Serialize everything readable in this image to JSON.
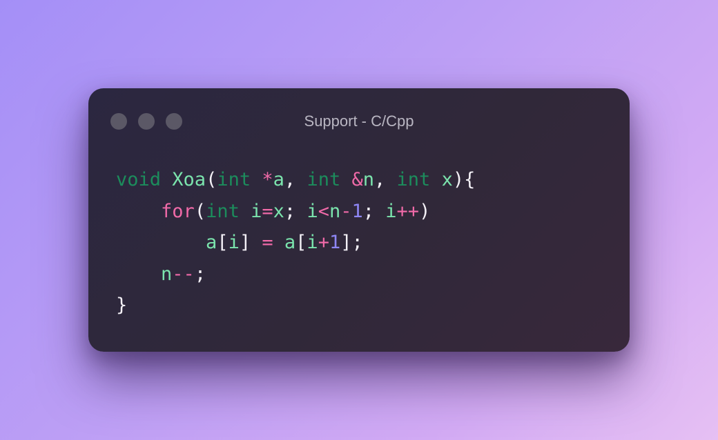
{
  "window": {
    "title": "Support - C/Cpp",
    "language": "C/C++",
    "buttons": [
      "close-dot",
      "minimize-dot",
      "maximize-dot"
    ]
  },
  "colors": {
    "background_start": "#a48ff7",
    "background_end": "#e6c0f3",
    "window_bg": "#2b2740",
    "keyword": "#1c8c5c",
    "identifier": "#7be4ad",
    "operator": "#f06aa8",
    "number": "#8e86f4",
    "punctuation": "#f3f0f6"
  },
  "code": {
    "lines": [
      [
        {
          "t": "void",
          "k": "kw"
        },
        {
          "t": " ",
          "k": "pu"
        },
        {
          "t": "Xoa",
          "k": "fn"
        },
        {
          "t": "(",
          "k": "pu"
        },
        {
          "t": "int",
          "k": "kw"
        },
        {
          "t": " ",
          "k": "pu"
        },
        {
          "t": "*",
          "k": "op"
        },
        {
          "t": "a",
          "k": "fn"
        },
        {
          "t": ", ",
          "k": "pu"
        },
        {
          "t": "int",
          "k": "kw"
        },
        {
          "t": " ",
          "k": "pu"
        },
        {
          "t": "&",
          "k": "op"
        },
        {
          "t": "n",
          "k": "fn"
        },
        {
          "t": ", ",
          "k": "pu"
        },
        {
          "t": "int",
          "k": "kw"
        },
        {
          "t": " ",
          "k": "pu"
        },
        {
          "t": "x",
          "k": "fn"
        },
        {
          "t": "){",
          "k": "pu"
        }
      ],
      [
        {
          "t": "    ",
          "k": "pu"
        },
        {
          "t": "for",
          "k": "op"
        },
        {
          "t": "(",
          "k": "pu"
        },
        {
          "t": "int",
          "k": "kw"
        },
        {
          "t": " ",
          "k": "pu"
        },
        {
          "t": "i",
          "k": "fn"
        },
        {
          "t": "=",
          "k": "op"
        },
        {
          "t": "x",
          "k": "fn"
        },
        {
          "t": "; ",
          "k": "pu"
        },
        {
          "t": "i",
          "k": "fn"
        },
        {
          "t": "<",
          "k": "op"
        },
        {
          "t": "n",
          "k": "fn"
        },
        {
          "t": "-",
          "k": "op"
        },
        {
          "t": "1",
          "k": "num"
        },
        {
          "t": "; ",
          "k": "pu"
        },
        {
          "t": "i",
          "k": "fn"
        },
        {
          "t": "++",
          "k": "op"
        },
        {
          "t": ")",
          "k": "pu"
        }
      ],
      [
        {
          "t": "        ",
          "k": "pu"
        },
        {
          "t": "a",
          "k": "fn"
        },
        {
          "t": "[",
          "k": "pu"
        },
        {
          "t": "i",
          "k": "fn"
        },
        {
          "t": "] ",
          "k": "pu"
        },
        {
          "t": "=",
          "k": "op"
        },
        {
          "t": " ",
          "k": "pu"
        },
        {
          "t": "a",
          "k": "fn"
        },
        {
          "t": "[",
          "k": "pu"
        },
        {
          "t": "i",
          "k": "fn"
        },
        {
          "t": "+",
          "k": "op"
        },
        {
          "t": "1",
          "k": "num"
        },
        {
          "t": "];",
          "k": "pu"
        }
      ],
      [
        {
          "t": "    ",
          "k": "pu"
        },
        {
          "t": "n",
          "k": "fn"
        },
        {
          "t": "--",
          "k": "op"
        },
        {
          "t": ";",
          "k": "pu"
        }
      ],
      [
        {
          "t": "}",
          "k": "pu"
        }
      ]
    ]
  }
}
